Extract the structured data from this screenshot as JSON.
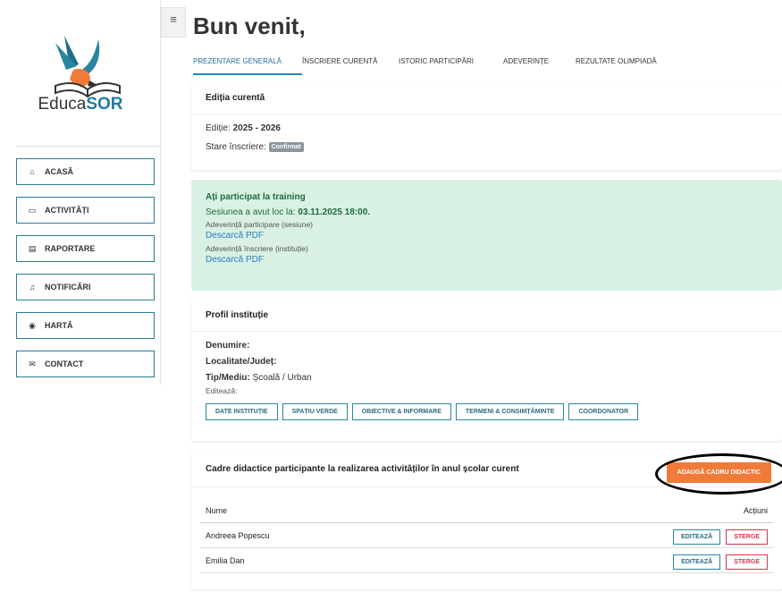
{
  "brand": {
    "name_a": "Educa",
    "name_b": "SOR"
  },
  "menu": [
    {
      "icon": "home-icon",
      "glyph": "⌂",
      "label": "ACASĂ"
    },
    {
      "icon": "calendar-icon",
      "glyph": "▭",
      "label": "ACTIVITĂȚI"
    },
    {
      "icon": "document-icon",
      "glyph": "▤",
      "label": "RAPORTARE"
    },
    {
      "icon": "bell-icon",
      "glyph": "♫",
      "label": "NOTIFICĂRI"
    },
    {
      "icon": "map-pin-icon",
      "glyph": "◉",
      "label": "HARTĂ"
    },
    {
      "icon": "mail-icon",
      "glyph": "✉",
      "label": "CONTACT"
    }
  ],
  "header": {
    "title": "Bun venit,"
  },
  "tabs": [
    "PREZENTARE GENERALĂ",
    "ÎNSCRIERE CURENTĂ",
    "ISTORIC PARTICIPĂRI",
    "ADEVERINȚE",
    "REZULTATE OLIMPIADĂ"
  ],
  "edition": {
    "title": "Ediția curentă",
    "edition_label": "Ediție:",
    "edition_value": "2025 - 2026",
    "status_label": "Stare înscriere:",
    "status_value": "Confirmat"
  },
  "training": {
    "title": "Ați participat la training",
    "session_prefix": "Sesiunea a avut loc la:",
    "session_value": "03.11.2025 18:00.",
    "cert_session": "Adeverință participare (sesiune)",
    "download1": "Descarcă PDF",
    "cert_institution": "Adeverință înscriere (instituție)",
    "download2": "Descarcă PDF"
  },
  "profile": {
    "title": "Profil instituție",
    "name_label": "Denumire:",
    "locality_label": "Localitate/Județ:",
    "type_label": "Tip/Mediu:",
    "type_value": "Școală / Urban",
    "edit_label": "Editează:",
    "buttons": [
      "DATE INSTITUȚIE",
      "SPAȚIU VERDE",
      "OBIECTIVE & INFORMARE",
      "TERMENI & CONSIMȚĂMINTE",
      "COORDONATOR"
    ]
  },
  "teachers": {
    "title": "Cadre didactice participante la realizarea activităților în anul școlar curent",
    "add_button": "ADAUGĂ CADRU DIDACTIC",
    "col_name": "Nume",
    "col_actions": "Acțiuni",
    "rows": [
      {
        "name": "Andreea Popescu",
        "edit": "EDITEAZĂ",
        "delete": "ȘTERGE"
      },
      {
        "name": "Emilia Dan",
        "edit": "EDITEAZĂ",
        "delete": "ȘTERGE"
      }
    ]
  }
}
